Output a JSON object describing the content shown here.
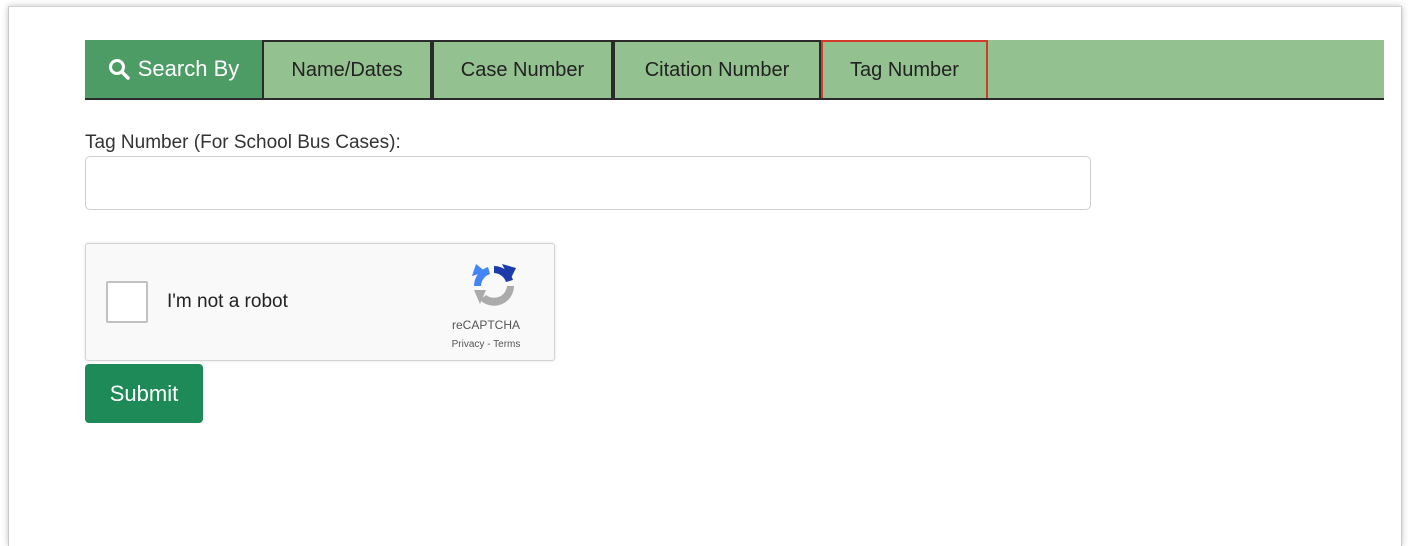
{
  "tabs": {
    "search_label": "Search By",
    "items": [
      {
        "label": "Name/Dates",
        "active": false
      },
      {
        "label": "Case Number",
        "active": false
      },
      {
        "label": "Citation Number",
        "active": false
      },
      {
        "label": "Tag Number",
        "active": true
      }
    ]
  },
  "form": {
    "tag_label": "Tag Number (For School Bus Cases):",
    "tag_value": "",
    "tag_placeholder": ""
  },
  "captcha": {
    "checkbox_label": "I'm not a robot",
    "brand": "reCAPTCHA",
    "privacy": "Privacy",
    "separator": " - ",
    "terms": "Terms"
  },
  "submit_label": "Submit",
  "colors": {
    "tab_bar": "#93c18f",
    "search_tab": "#4d9c66",
    "active_border": "#d23a2a",
    "submit": "#1e8a57"
  },
  "icons": {
    "search": "magnifier-icon",
    "captcha": "recaptcha-logo-icon"
  }
}
